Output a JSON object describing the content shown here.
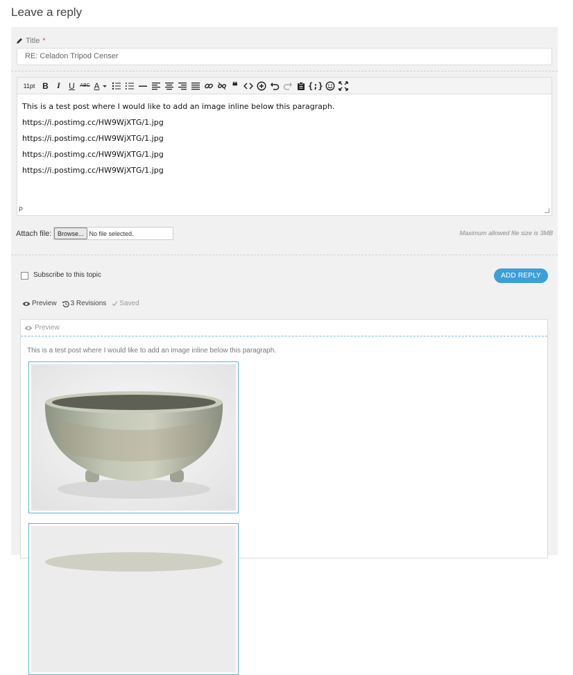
{
  "page": {
    "title": "Leave a reply"
  },
  "form": {
    "title_label": "Title",
    "title_required": "*",
    "title_value": "RE: Celadon Tripod Censer",
    "toolbar": {
      "font_size": "11pt",
      "bold": "B",
      "italic": "I",
      "underline": "U",
      "strikethrough": "ABC",
      "text_color": "A"
    },
    "content": [
      "This is a test post where I would like to add an image inline below this paragraph.",
      "https://i.postimg.cc/HW9WjXTG/1.jpg",
      "https://i.postimg.cc/HW9WjXTG/1.jpg",
      "https://i.postimg.cc/HW9WjXTG/1.jpg",
      "https://i.postimg.cc/HW9WjXTG/1.jpg"
    ],
    "path_indicator": "P",
    "attach_label": "Attach file:",
    "browse_label": "Browse...",
    "no_file": "No file selected.",
    "max_size": "Maximum allowed file size is 3MB",
    "subscribe_label": "Subscribe to this topic",
    "add_reply": "ADD REPLY"
  },
  "preview_bar": {
    "preview": "Preview",
    "revisions": "3 Revisions",
    "saved": "Saved"
  },
  "preview": {
    "header": "Preview",
    "text": "This is a test post where I would like to add an image inline below this paragraph."
  },
  "colors": {
    "accent": "#3d9fd8",
    "panel": "#f1f1f1",
    "required": "#e74c3c",
    "image_border": "#5cb4d6"
  }
}
